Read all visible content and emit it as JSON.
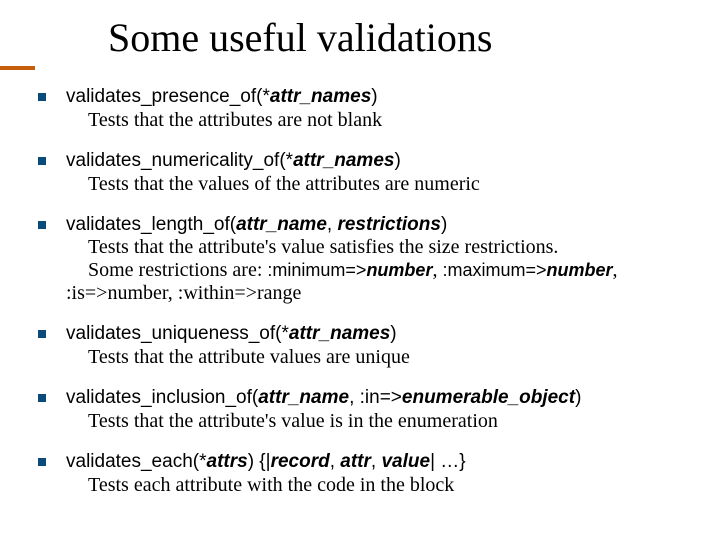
{
  "title": "Some useful validations",
  "items": [
    {
      "fn": "validates_presence_of",
      "args_open": "(*",
      "arg1": "attr_names",
      "args_close": ")",
      "desc1": "Tests that the attributes are not blank"
    },
    {
      "fn": "validates_numericality_of",
      "args_open": "(*",
      "arg1": "attr_names",
      "args_close": ")",
      "desc1": "Tests that the values of the attributes are numeric"
    },
    {
      "fn": "validates_length_of",
      "args_open": "(",
      "arg1": "attr_name",
      "mid1": ", ",
      "arg2": "restrictions",
      "args_close": ")",
      "desc1": "Tests that the attribute's value satisfies the size restrictions.",
      "desc2a": "Some restrictions are: ",
      "kw1": ":minimum=>",
      "kv1": "number",
      "sep1": ", ",
      "kw2": ":maximum=>",
      "kv2": "number",
      "sep2": ",",
      "line3_kw1": ":is=>",
      "line3_kv1": "number",
      "line3_sep1": ", ",
      "line3_kw2": ":within=>",
      "line3_kv2": "range"
    },
    {
      "fn": "validates_uniqueness_of",
      "args_open": "(*",
      "arg1": "attr_names",
      "args_close": ")",
      "desc1": "Tests that the attribute values are unique"
    },
    {
      "fn": "validates_inclusion_of",
      "args_open": "(",
      "arg1": "attr_name",
      "mid1": ", ",
      "kw_in": ":in=>",
      "arg2": "enumerable_object",
      "args_close": ")",
      "desc1": "Tests that the attribute's value is in the enumeration"
    },
    {
      "fn": "validates_each",
      "args_open": "(*",
      "arg1": "attrs",
      "args_close": ") {|",
      "blk1": "record",
      "bsep1": ", ",
      "blk2": "attr",
      "bsep2": ", ",
      "blk3": "value",
      "blk_close": "| …}",
      "desc1": "Tests each attribute with the code in the block"
    }
  ]
}
